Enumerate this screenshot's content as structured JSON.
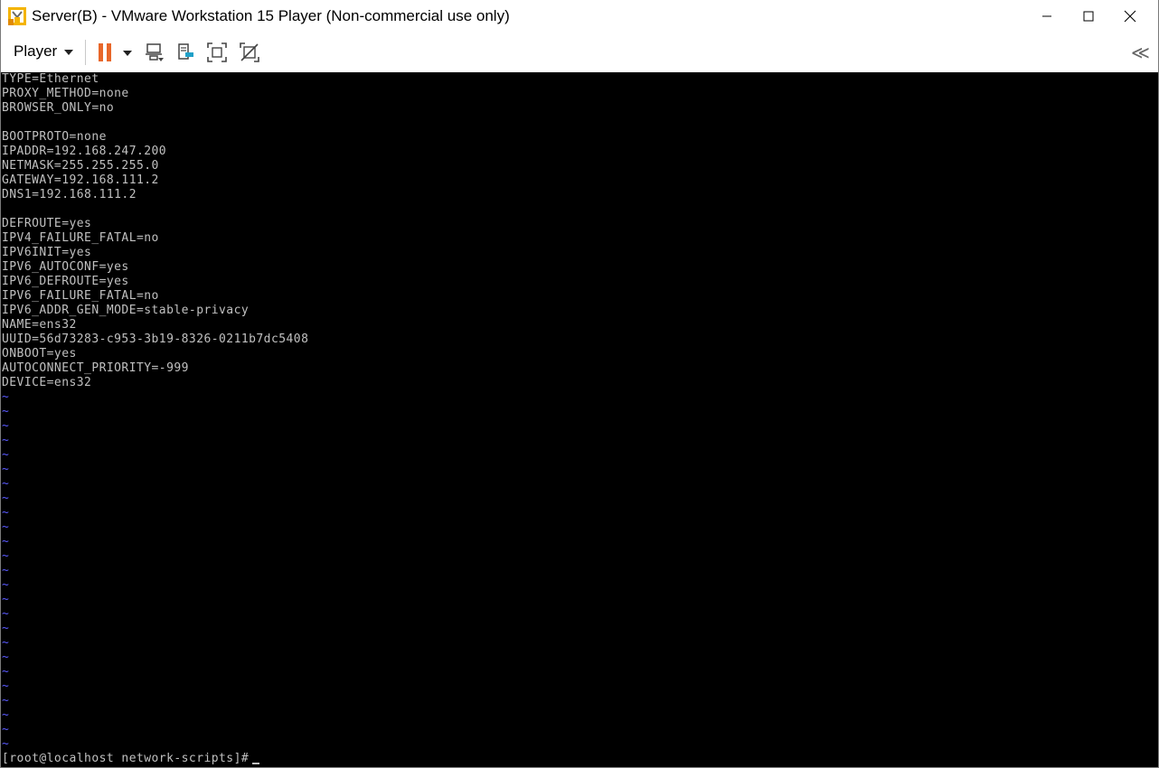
{
  "window": {
    "title": "Server(B) - VMware Workstation 15 Player (Non-commercial use only)"
  },
  "toolbar": {
    "player_label": "Player",
    "pause_color": "#e8672a",
    "collapse_glyph": "≪"
  },
  "console": {
    "text_color": "#c0c0c0",
    "tilde_color": "#5a5aff",
    "lines": [
      "TYPE=Ethernet",
      "PROXY_METHOD=none",
      "BROWSER_ONLY=no",
      "",
      "BOOTPROTO=none",
      "IPADDR=192.168.247.200",
      "NETMASK=255.255.255.0",
      "GATEWAY=192.168.111.2",
      "DNS1=192.168.111.2",
      "",
      "DEFROUTE=yes",
      "IPV4_FAILURE_FATAL=no",
      "IPV6INIT=yes",
      "IPV6_AUTOCONF=yes",
      "IPV6_DEFROUTE=yes",
      "IPV6_FAILURE_FATAL=no",
      "IPV6_ADDR_GEN_MODE=stable-privacy",
      "NAME=ens32",
      "UUID=56d73283-c953-3b19-8326-0211b7dc5408",
      "ONBOOT=yes",
      "AUTOCONNECT_PRIORITY=-999",
      "DEVICE=ens32",
      "~",
      "~",
      "~",
      "~",
      "~",
      "~",
      "~",
      "~",
      "~",
      "~",
      "~",
      "~",
      "~",
      "~",
      "~",
      "~",
      "~",
      "~",
      "~",
      "~",
      "~",
      "~",
      "~",
      "~",
      "~"
    ],
    "prompt": "[root@localhost network-scripts]#"
  }
}
